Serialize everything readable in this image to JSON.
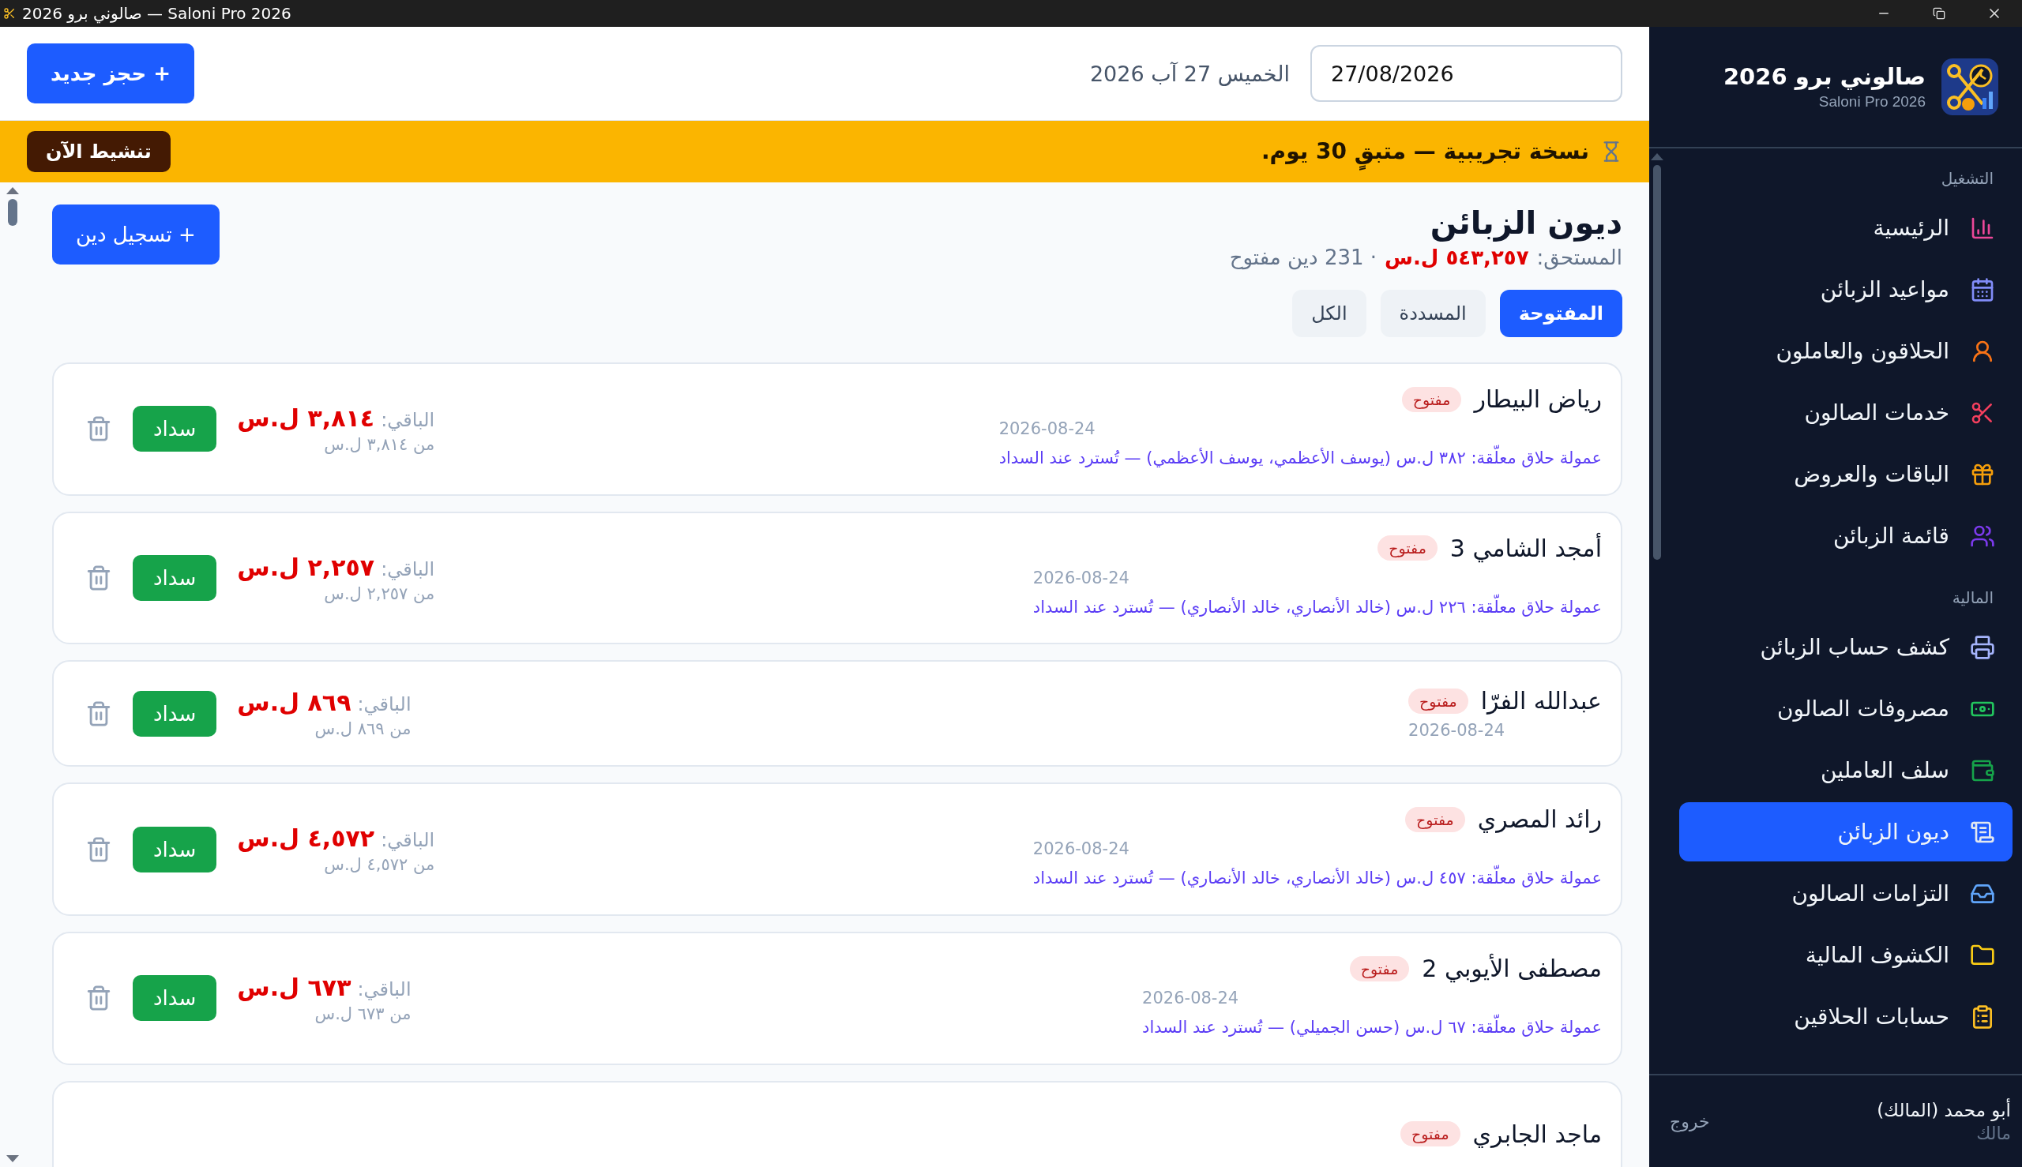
{
  "window": {
    "title": "صالوني برو 2026 — Saloni Pro 2026"
  },
  "header": {
    "date_value": "27/08/2026",
    "date_label": "الخميس 27 آب 2026",
    "new_booking_button": "+ حجز جديد"
  },
  "trial_banner": {
    "text": "نسخة تجريبية — متبقٍ 30 يوم.",
    "button": "تنشيط الآن"
  },
  "page": {
    "title": "ديون الزبائن",
    "due_label": "المستحق:",
    "due_amount": "٥٤٣,٢٥٧ ل.س",
    "count": "· 231 دين مفتوح",
    "add_button": "+ تسجيل دين"
  },
  "filters": [
    {
      "label": "المفتوحة",
      "selected": true
    },
    {
      "label": "المسددة",
      "selected": false
    },
    {
      "label": "الكل",
      "selected": false
    }
  ],
  "debts": [
    {
      "name": "رياض البيطار",
      "status": "مفتوح",
      "date": "2026-08-24",
      "note": "عمولة حلاق معلّقة: ٣٨٢ ل.س (يوسف الأعظمي، يوسف الأعظمي) — تُسترد عند السداد",
      "remaining_label": "الباقي:",
      "remaining": "٣,٨١٤ ل.س",
      "total": "من ٣,٨١٤ ل.س",
      "pay_button": "سداد"
    },
    {
      "name": "أمجد الشامي 3",
      "status": "مفتوح",
      "date": "2026-08-24",
      "note": "عمولة حلاق معلّقة: ٢٢٦ ل.س (خالد الأنصاري، خالد الأنصاري) — تُسترد عند السداد",
      "remaining_label": "الباقي:",
      "remaining": "٢,٢٥٧ ل.س",
      "total": "من ٢,٢٥٧ ل.س",
      "pay_button": "سداد"
    },
    {
      "name": "عبدالله الفرّا",
      "status": "مفتوح",
      "date": "2026-08-24",
      "remaining_label": "الباقي:",
      "remaining": "٨٦٩ ل.س",
      "total": "من ٨٦٩ ل.س",
      "pay_button": "سداد"
    },
    {
      "name": "رائد المصري",
      "status": "مفتوح",
      "date": "2026-08-24",
      "note": "عمولة حلاق معلّقة: ٤٥٧ ل.س (خالد الأنصاري، خالد الأنصاري) — تُسترد عند السداد",
      "remaining_label": "الباقي:",
      "remaining": "٤,٥٧٢ ل.س",
      "total": "من ٤,٥٧٢ ل.س",
      "pay_button": "سداد"
    },
    {
      "name": "مصطفى الأيوبي 2",
      "status": "مفتوح",
      "date": "2026-08-24",
      "note": "عمولة حلاق معلّقة: ٦٧ ل.س (حسن الجميلي) — تُسترد عند السداد",
      "remaining_label": "الباقي:",
      "remaining": "٦٧٣ ل.س",
      "total": "من ٦٧٣ ل.س",
      "pay_button": "سداد"
    },
    {
      "name": "ماجد الجابري",
      "status": "مفتوح"
    }
  ],
  "sidebar": {
    "app_name": "صالوني برو 2026",
    "app_subtitle": "Saloni Pro 2026",
    "sections": [
      {
        "title": "التشغيل",
        "items": [
          {
            "label": "الرئيسية",
            "selected": false
          },
          {
            "label": "مواعيد الزبائن",
            "selected": false
          },
          {
            "label": "الحلاقون والعاملون",
            "selected": false
          },
          {
            "label": "خدمات الصالون",
            "selected": false
          },
          {
            "label": "الباقات والعروض",
            "selected": false
          },
          {
            "label": "قائمة الزبائن",
            "selected": false
          }
        ]
      },
      {
        "title": "المالية",
        "items": [
          {
            "label": "كشف حساب الزبائن",
            "selected": false
          },
          {
            "label": "مصروفات الصالون",
            "selected": false
          },
          {
            "label": "سلف العاملين",
            "selected": false
          },
          {
            "label": "ديون الزبائن",
            "selected": true
          },
          {
            "label": "التزامات الصالون",
            "selected": false
          },
          {
            "label": "الكشوف المالية",
            "selected": false
          },
          {
            "label": "حسابات الحلاقين",
            "selected": false
          }
        ]
      }
    ],
    "user": {
      "name": "أبو محمد (المالك)",
      "role": "مالك"
    },
    "logout": "خروج"
  }
}
